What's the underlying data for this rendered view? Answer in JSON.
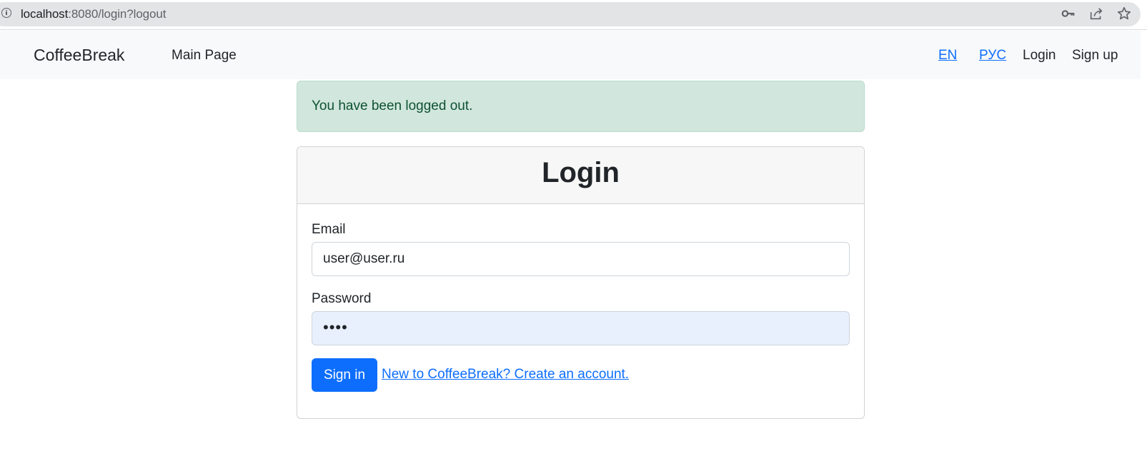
{
  "browser": {
    "url_host": "localhost",
    "url_path": ":8080/login?logout",
    "icons": [
      "info-icon",
      "key-icon",
      "share-icon",
      "star-icon"
    ]
  },
  "navbar": {
    "brand": "CoffeeBreak",
    "main_link": "Main Page",
    "lang_en": "EN",
    "lang_ru": "РУС",
    "login": "Login",
    "signup": "Sign up"
  },
  "alert": {
    "message": "You have been logged out."
  },
  "login_form": {
    "title": "Login",
    "email_label": "Email",
    "email_value": "user@user.ru",
    "password_label": "Password",
    "password_value": "••••",
    "submit_label": "Sign in",
    "signup_link": "New to CoffeeBreak? Create an account."
  },
  "colors": {
    "primary": "#0d6efd",
    "alert_bg": "#d1e7dd",
    "alert_text": "#0f5132",
    "navbar_bg": "#f8f9fa",
    "autofill_bg": "#e8f0fe"
  }
}
